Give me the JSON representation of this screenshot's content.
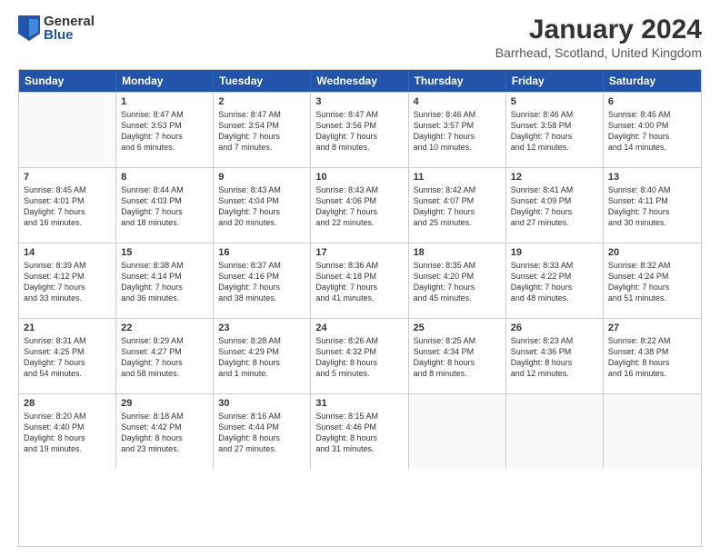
{
  "logo": {
    "general": "General",
    "blue": "Blue"
  },
  "title": "January 2024",
  "location": "Barrhead, Scotland, United Kingdom",
  "days_header": [
    "Sunday",
    "Monday",
    "Tuesday",
    "Wednesday",
    "Thursday",
    "Friday",
    "Saturday"
  ],
  "weeks": [
    [
      {
        "day": "",
        "lines": []
      },
      {
        "day": "1",
        "lines": [
          "Sunrise: 8:47 AM",
          "Sunset: 3:53 PM",
          "Daylight: 7 hours",
          "and 6 minutes."
        ]
      },
      {
        "day": "2",
        "lines": [
          "Sunrise: 8:47 AM",
          "Sunset: 3:54 PM",
          "Daylight: 7 hours",
          "and 7 minutes."
        ]
      },
      {
        "day": "3",
        "lines": [
          "Sunrise: 8:47 AM",
          "Sunset: 3:56 PM",
          "Daylight: 7 hours",
          "and 8 minutes."
        ]
      },
      {
        "day": "4",
        "lines": [
          "Sunrise: 8:46 AM",
          "Sunset: 3:57 PM",
          "Daylight: 7 hours",
          "and 10 minutes."
        ]
      },
      {
        "day": "5",
        "lines": [
          "Sunrise: 8:46 AM",
          "Sunset: 3:58 PM",
          "Daylight: 7 hours",
          "and 12 minutes."
        ]
      },
      {
        "day": "6",
        "lines": [
          "Sunrise: 8:45 AM",
          "Sunset: 4:00 PM",
          "Daylight: 7 hours",
          "and 14 minutes."
        ]
      }
    ],
    [
      {
        "day": "7",
        "lines": [
          "Sunrise: 8:45 AM",
          "Sunset: 4:01 PM",
          "Daylight: 7 hours",
          "and 16 minutes."
        ]
      },
      {
        "day": "8",
        "lines": [
          "Sunrise: 8:44 AM",
          "Sunset: 4:03 PM",
          "Daylight: 7 hours",
          "and 18 minutes."
        ]
      },
      {
        "day": "9",
        "lines": [
          "Sunrise: 8:43 AM",
          "Sunset: 4:04 PM",
          "Daylight: 7 hours",
          "and 20 minutes."
        ]
      },
      {
        "day": "10",
        "lines": [
          "Sunrise: 8:43 AM",
          "Sunset: 4:06 PM",
          "Daylight: 7 hours",
          "and 22 minutes."
        ]
      },
      {
        "day": "11",
        "lines": [
          "Sunrise: 8:42 AM",
          "Sunset: 4:07 PM",
          "Daylight: 7 hours",
          "and 25 minutes."
        ]
      },
      {
        "day": "12",
        "lines": [
          "Sunrise: 8:41 AM",
          "Sunset: 4:09 PM",
          "Daylight: 7 hours",
          "and 27 minutes."
        ]
      },
      {
        "day": "13",
        "lines": [
          "Sunrise: 8:40 AM",
          "Sunset: 4:11 PM",
          "Daylight: 7 hours",
          "and 30 minutes."
        ]
      }
    ],
    [
      {
        "day": "14",
        "lines": [
          "Sunrise: 8:39 AM",
          "Sunset: 4:12 PM",
          "Daylight: 7 hours",
          "and 33 minutes."
        ]
      },
      {
        "day": "15",
        "lines": [
          "Sunrise: 8:38 AM",
          "Sunset: 4:14 PM",
          "Daylight: 7 hours",
          "and 36 minutes."
        ]
      },
      {
        "day": "16",
        "lines": [
          "Sunrise: 8:37 AM",
          "Sunset: 4:16 PM",
          "Daylight: 7 hours",
          "and 38 minutes."
        ]
      },
      {
        "day": "17",
        "lines": [
          "Sunrise: 8:36 AM",
          "Sunset: 4:18 PM",
          "Daylight: 7 hours",
          "and 41 minutes."
        ]
      },
      {
        "day": "18",
        "lines": [
          "Sunrise: 8:35 AM",
          "Sunset: 4:20 PM",
          "Daylight: 7 hours",
          "and 45 minutes."
        ]
      },
      {
        "day": "19",
        "lines": [
          "Sunrise: 8:33 AM",
          "Sunset: 4:22 PM",
          "Daylight: 7 hours",
          "and 48 minutes."
        ]
      },
      {
        "day": "20",
        "lines": [
          "Sunrise: 8:32 AM",
          "Sunset: 4:24 PM",
          "Daylight: 7 hours",
          "and 51 minutes."
        ]
      }
    ],
    [
      {
        "day": "21",
        "lines": [
          "Sunrise: 8:31 AM",
          "Sunset: 4:25 PM",
          "Daylight: 7 hours",
          "and 54 minutes."
        ]
      },
      {
        "day": "22",
        "lines": [
          "Sunrise: 8:29 AM",
          "Sunset: 4:27 PM",
          "Daylight: 7 hours",
          "and 58 minutes."
        ]
      },
      {
        "day": "23",
        "lines": [
          "Sunrise: 8:28 AM",
          "Sunset: 4:29 PM",
          "Daylight: 8 hours",
          "and 1 minute."
        ]
      },
      {
        "day": "24",
        "lines": [
          "Sunrise: 8:26 AM",
          "Sunset: 4:32 PM",
          "Daylight: 8 hours",
          "and 5 minutes."
        ]
      },
      {
        "day": "25",
        "lines": [
          "Sunrise: 8:25 AM",
          "Sunset: 4:34 PM",
          "Daylight: 8 hours",
          "and 8 minutes."
        ]
      },
      {
        "day": "26",
        "lines": [
          "Sunrise: 8:23 AM",
          "Sunset: 4:36 PM",
          "Daylight: 8 hours",
          "and 12 minutes."
        ]
      },
      {
        "day": "27",
        "lines": [
          "Sunrise: 8:22 AM",
          "Sunset: 4:38 PM",
          "Daylight: 8 hours",
          "and 16 minutes."
        ]
      }
    ],
    [
      {
        "day": "28",
        "lines": [
          "Sunrise: 8:20 AM",
          "Sunset: 4:40 PM",
          "Daylight: 8 hours",
          "and 19 minutes."
        ]
      },
      {
        "day": "29",
        "lines": [
          "Sunrise: 8:18 AM",
          "Sunset: 4:42 PM",
          "Daylight: 8 hours",
          "and 23 minutes."
        ]
      },
      {
        "day": "30",
        "lines": [
          "Sunrise: 8:16 AM",
          "Sunset: 4:44 PM",
          "Daylight: 8 hours",
          "and 27 minutes."
        ]
      },
      {
        "day": "31",
        "lines": [
          "Sunrise: 8:15 AM",
          "Sunset: 4:46 PM",
          "Daylight: 8 hours",
          "and 31 minutes."
        ]
      },
      {
        "day": "",
        "lines": []
      },
      {
        "day": "",
        "lines": []
      },
      {
        "day": "",
        "lines": []
      }
    ]
  ]
}
